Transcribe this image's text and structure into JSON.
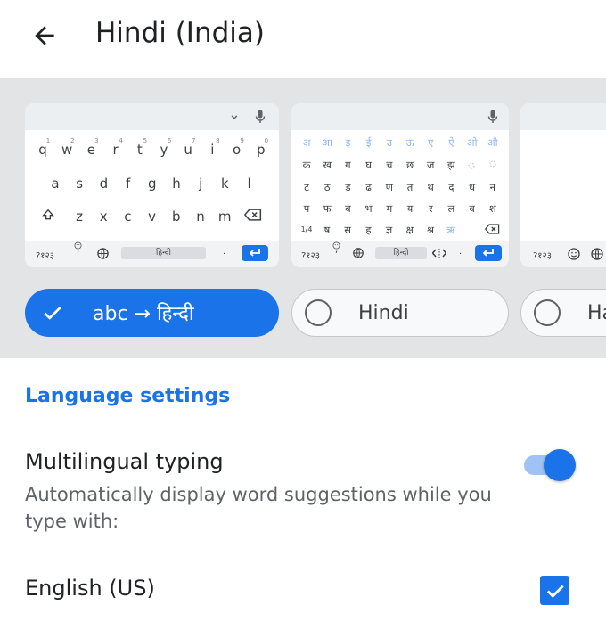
{
  "header": {
    "title": "Hindi (India)",
    "back_icon": "arrow-left-icon"
  },
  "layouts": [
    {
      "name": "abc → हिन्दी",
      "selected": true,
      "preview": {
        "row1": [
          "q",
          "w",
          "e",
          "r",
          "t",
          "y",
          "u",
          "i",
          "o",
          "p"
        ],
        "row1_hints": [
          "1",
          "2",
          "3",
          "4",
          "5",
          "6",
          "7",
          "8",
          "9",
          "0"
        ],
        "row2": [
          "a",
          "s",
          "d",
          "f",
          "g",
          "h",
          "j",
          "k",
          "l"
        ],
        "row3": [
          "z",
          "x",
          "c",
          "v",
          "b",
          "n",
          "m"
        ],
        "symbols_key": "?१२३",
        "comma_key": ",",
        "space_label": "हिन्दी",
        "period_key": "."
      }
    },
    {
      "name": "Hindi",
      "selected": false,
      "preview": {
        "vowels": [
          "अ",
          "आ",
          "इ",
          "ई",
          "उ",
          "ऊ",
          "ए",
          "ऐ",
          "ओ",
          "औ"
        ],
        "row1": [
          "क",
          "ख",
          "ग",
          "घ",
          "च",
          "छ",
          "ज",
          "झ"
        ],
        "row2": [
          "ट",
          "ठ",
          "ड",
          "ढ",
          "ण",
          "त",
          "थ",
          "द",
          "ध",
          "न"
        ],
        "row3": [
          "प",
          "फ",
          "ब",
          "भ",
          "म",
          "य",
          "र",
          "ल",
          "व",
          "श"
        ],
        "row4_page": "1/4",
        "row4": [
          "ष",
          "स",
          "ह",
          "ज्ञ",
          "क्ष",
          "श्र",
          "ऋ"
        ],
        "symbols_key": "?१२३",
        "comma_key": ",",
        "space_label": "हिन्दी",
        "period_key": "."
      }
    },
    {
      "name": "Ha",
      "selected": false,
      "preview": {
        "symbols_key": "?१२३"
      }
    }
  ],
  "settings": {
    "section_title": "Language settings",
    "multilingual": {
      "title": "Multilingual typing",
      "subtitle": "Automatically display word suggestions while you type with:",
      "enabled": true
    },
    "languages": [
      {
        "label": "English (US)",
        "checked": true
      }
    ]
  },
  "colors": {
    "accent": "#1a73e8",
    "strip_bg": "#e3e4e6"
  }
}
